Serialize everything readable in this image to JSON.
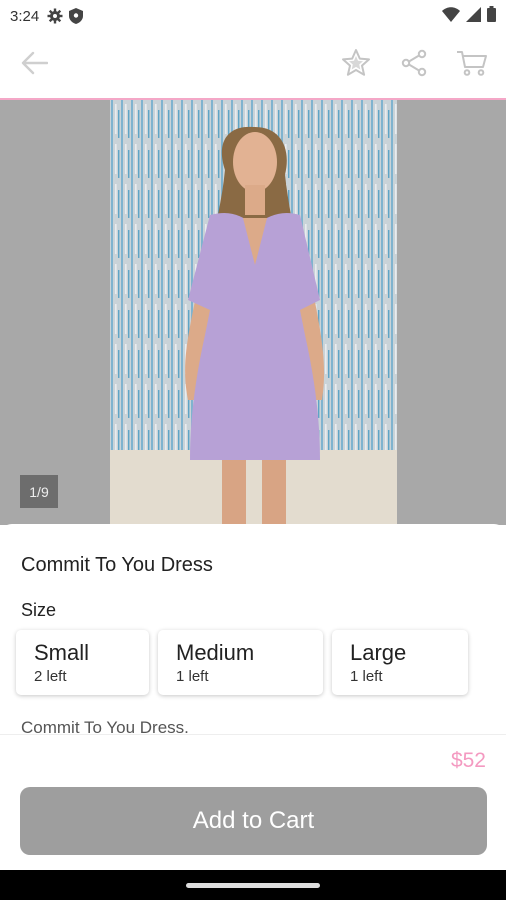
{
  "status_bar": {
    "time": "3:24",
    "icons": [
      "gear-icon",
      "shield-icon",
      "wifi-icon",
      "signal-icon",
      "battery-icon"
    ]
  },
  "app_bar": {
    "icons": [
      "back-arrow-icon",
      "star-icon",
      "share-icon",
      "cart-icon"
    ],
    "accent_color": "#f4a7c7"
  },
  "gallery": {
    "counter": "1/9"
  },
  "product": {
    "title": "Commit To You Dress",
    "size_label": "Size",
    "sizes": [
      {
        "name": "Small",
        "stock": "2 left"
      },
      {
        "name": "Medium",
        "stock": "1 left"
      },
      {
        "name": "Large",
        "stock": "1 left"
      }
    ],
    "description": "Commit To You Dress.",
    "price": "$52",
    "price_color": "#f49ac1"
  },
  "cart_button": {
    "label": "Add to Cart",
    "color": "#9e9e9e"
  }
}
